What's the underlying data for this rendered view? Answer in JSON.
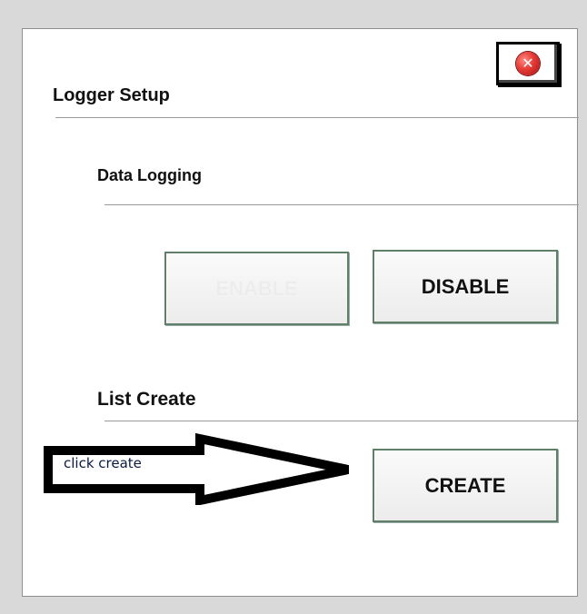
{
  "dialog": {
    "title": "Logger Setup",
    "close_icon": "close-icon",
    "close_glyph": "✕"
  },
  "data_logging": {
    "label": "Data Logging",
    "enable_label": "ENABLE",
    "enable_state": "disabled",
    "disable_label": "DISABLE"
  },
  "list_create": {
    "label": "List Create",
    "create_label": "CREATE"
  },
  "annotation": {
    "text": "click create"
  },
  "colors": {
    "background": "#d9d9d9",
    "panel": "#ffffff",
    "button_border": "#5f7f68",
    "close_red": "#e53935"
  }
}
